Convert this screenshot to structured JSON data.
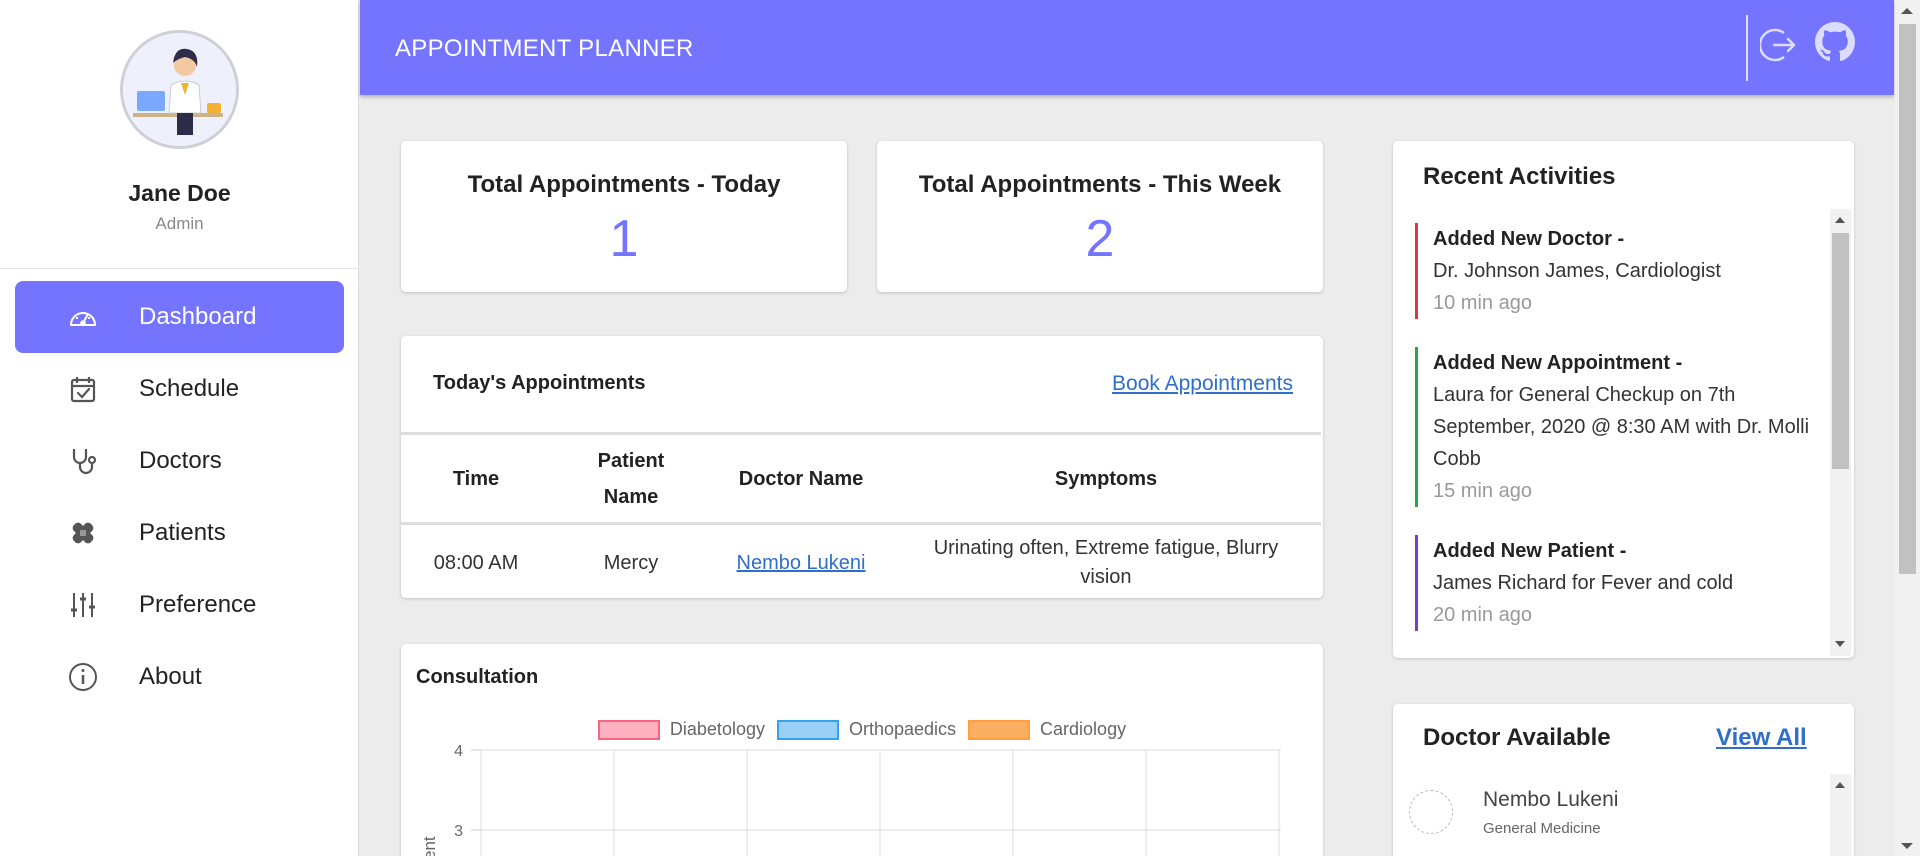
{
  "user": {
    "name": "Jane Doe",
    "role": "Admin"
  },
  "nav": [
    {
      "label": "Dashboard",
      "icon": "speedometer-icon",
      "active": true
    },
    {
      "label": "Schedule",
      "icon": "calendar-check-icon"
    },
    {
      "label": "Doctors",
      "icon": "stethoscope-icon"
    },
    {
      "label": "Patients",
      "icon": "bandage-icon"
    },
    {
      "label": "Preference",
      "icon": "sliders-icon"
    },
    {
      "label": "About",
      "icon": "info-icon"
    }
  ],
  "header": {
    "title": "APPOINTMENT PLANNER",
    "logout_icon": "logout-icon",
    "github_icon": "github-icon"
  },
  "stats": {
    "today_label": "Total Appointments - Today",
    "today_value": "1",
    "week_label": "Total Appointments - This Week",
    "week_value": "2"
  },
  "appointments": {
    "title": "Today's Appointments",
    "book_link": "Book Appointments",
    "columns": [
      "Time",
      "Patient Name",
      "Doctor Name",
      "Symptoms"
    ],
    "rows": [
      {
        "time": "08:00 AM",
        "patient": "Mercy",
        "doctor": "Nembo Lukeni",
        "symptoms": "Urinating often, Extreme fatigue, Blurry vision"
      }
    ]
  },
  "consultation": {
    "title": "Consultation",
    "legend": [
      {
        "name": "Diabetology",
        "fill": "#ffb1c1",
        "border": "#ff6384"
      },
      {
        "name": "Orthopaedics",
        "fill": "#9ad0f5",
        "border": "#36a2eb"
      },
      {
        "name": "Cardiology",
        "fill": "#f9ae60",
        "border": "#ff9f40"
      }
    ],
    "y_ticks": [
      "4",
      "3"
    ],
    "y_axis_label": "ent"
  },
  "recent_activities": {
    "title": "Recent Activities",
    "items": [
      {
        "heading": "Added New Doctor -",
        "detail": "Dr. Johnson James, Cardiologist",
        "time": "10 min ago",
        "color": "#dc3545"
      },
      {
        "heading": "Added New Appointment -",
        "detail": "Laura for General Checkup on 7th September, 2020 @ 8:30 AM with Dr. Molli Cobb",
        "time": "15 min ago",
        "color": "#28a745"
      },
      {
        "heading": "Added New Patient -",
        "detail": "James Richard for Fever and cold",
        "time": "20 min ago",
        "color": "#6f42c1"
      }
    ]
  },
  "doctors_available": {
    "title": "Doctor Available",
    "view_all": "View All",
    "doctors": [
      {
        "name": "Nembo Lukeni",
        "specialty": "General Medicine"
      }
    ]
  }
}
